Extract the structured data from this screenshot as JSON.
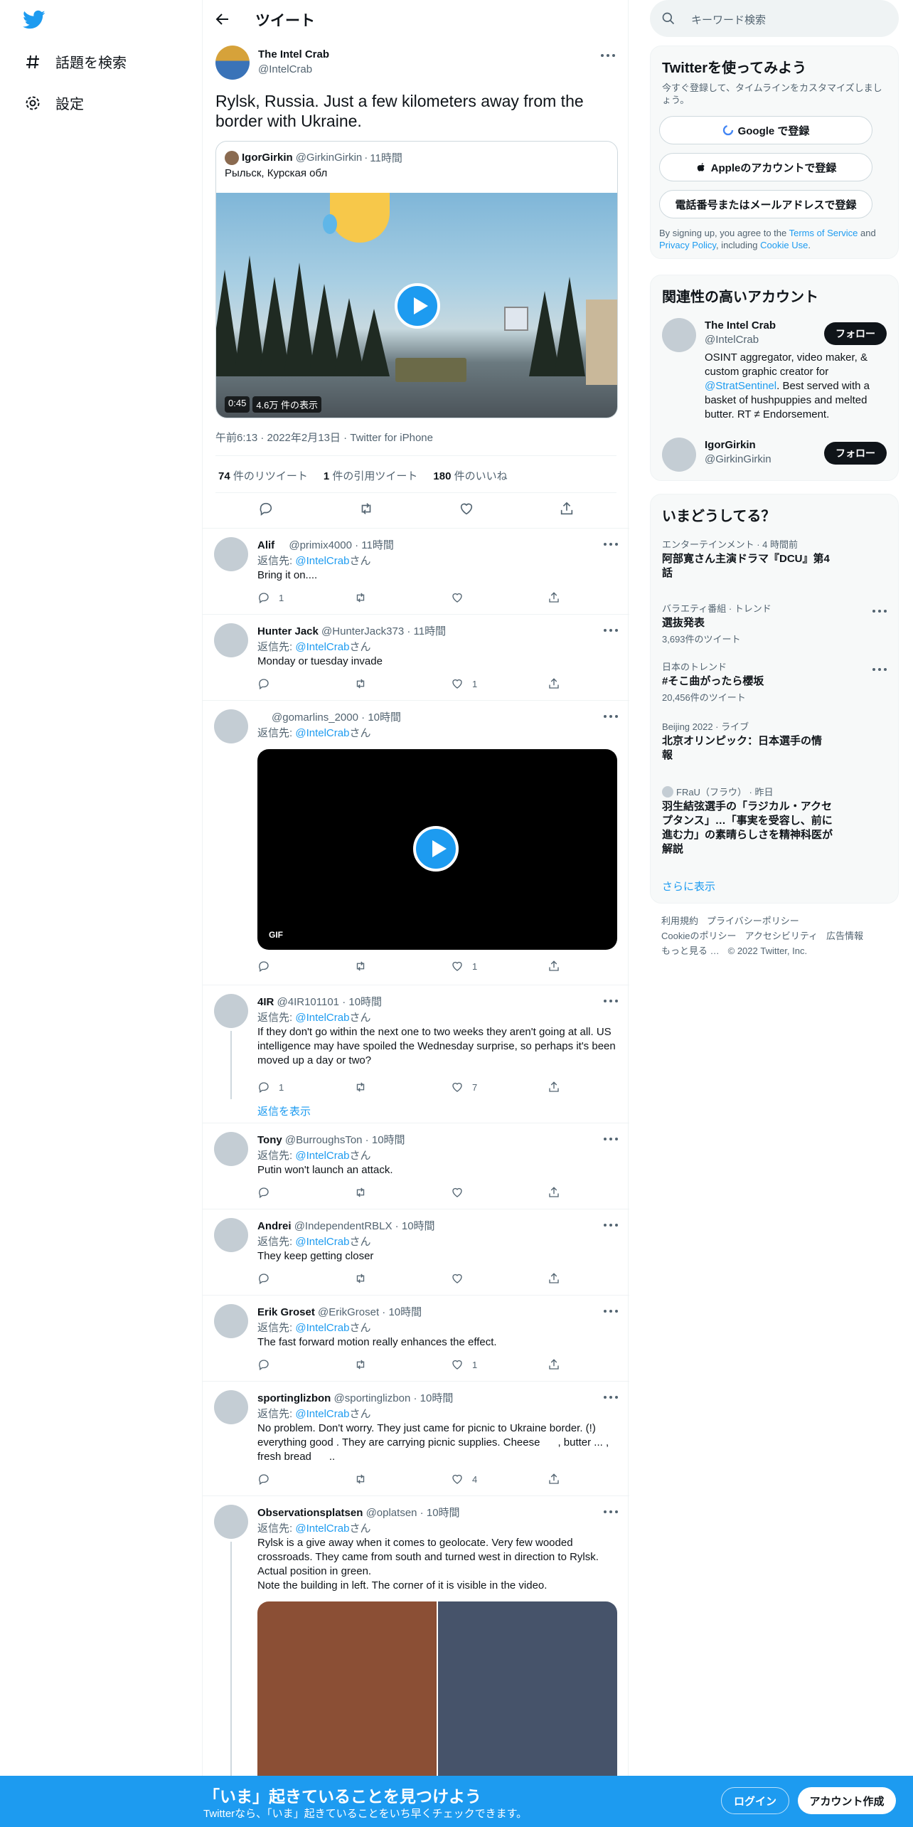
{
  "nav": {
    "items": [
      {
        "label": "話題を検索",
        "icon": "hashtag-icon"
      },
      {
        "label": "設定",
        "icon": "gear-icon"
      }
    ]
  },
  "header": {
    "title": "ツイート"
  },
  "tweet": {
    "author_name": "The Intel Crab",
    "author_handle": "@IntelCrab",
    "text": "Rylsk, Russia. Just a few kilometers away from the border with Ukraine.",
    "quote": {
      "author_name": "IgorGirkin",
      "author_handle": "@GirkinGirkin",
      "time": "11時間",
      "text": "Рыльск, Курская обл",
      "video_duration": "0:45",
      "video_views": "4.6万 件の表示"
    },
    "timestamp": "午前6:13 · 2022年2月13日 · Twitter for iPhone",
    "retweets": "74",
    "retweets_label": "件のリツイート",
    "quotes": "1",
    "quotes_label": "件の引用ツイート",
    "likes": "180",
    "likes_label": "件のいいね"
  },
  "replies": [
    {
      "name": "Alif",
      "handle": "@primix4000",
      "time": "11時間",
      "reply_to": "@IntelCrab",
      "text": "Bring it on....",
      "replies": "1",
      "likes": ""
    },
    {
      "name": "Hunter Jack",
      "handle": "@HunterJack373",
      "time": "11時間",
      "reply_to": "@IntelCrab",
      "text": "Monday or tuesday invade",
      "replies": "",
      "likes": "1"
    },
    {
      "name": "",
      "handle": "@gomarlins_2000",
      "time": "10時間",
      "reply_to": "@IntelCrab",
      "text": "",
      "gif_label": "GIF",
      "replies": "",
      "likes": "1"
    },
    {
      "name": "4IR",
      "handle": "@4IR101101",
      "time": "10時間",
      "reply_to": "@IntelCrab",
      "text": "If they don't go within the next one to two weeks they aren't going at all. US intelligence may have spoiled the Wednesday surprise, so perhaps it's been moved up a day or two?",
      "replies": "1",
      "likes": "7",
      "show_replies": "返信を表示"
    },
    {
      "name": "Tony",
      "handle": "@BurroughsTon",
      "time": "10時間",
      "reply_to": "@IntelCrab",
      "text": "Putin won't launch an attack.",
      "replies": "",
      "likes": ""
    },
    {
      "name": "Andrei",
      "handle": "@IndependentRBLX",
      "time": "10時間",
      "reply_to": "@IntelCrab",
      "text": "They keep getting closer",
      "replies": "",
      "likes": ""
    },
    {
      "name": "Erik Groset",
      "handle": "@ErikGroset",
      "time": "10時間",
      "reply_to": "@IntelCrab",
      "text": "The fast forward motion really enhances the effect.",
      "replies": "",
      "likes": "1"
    },
    {
      "name": "sportinglizbon",
      "handle": "@sportinglizbon",
      "time": "10時間",
      "reply_to": "@IntelCrab",
      "text": "No problem. Don't worry. They just came for picnic to Ukraine border. (!) everything good . They are carrying picnic supplies. Cheese      , butter ... , fresh bread      ..",
      "replies": "",
      "likes": "4"
    },
    {
      "name": "Observationsplatsen",
      "handle": "@oplatsen",
      "time": "10時間",
      "reply_to": "@IntelCrab",
      "text": "Rylsk is a give away when it comes to geolocate. Very few wooded crossroads. They came from south and turned west in direction to Rylsk. Actual position in green.\nNote the building in left. The corner of it is visible in the video."
    }
  ],
  "reply_prefix": "返信先: ",
  "reply_suffix": "さん",
  "search": {
    "placeholder": "キーワード検索"
  },
  "signup_card": {
    "title": "Twitterを使ってみよう",
    "subtitle": "今すぐ登録して、タイムラインをカスタマイズしましょう。",
    "google": "Google で登録",
    "apple": "Appleのアカウントで登録",
    "phone": "電話番号またはメールアドレスで登録",
    "terms_pre": "By signing up, you agree to the ",
    "terms_link": "Terms of Service",
    "terms_and": " and ",
    "privacy_link": "Privacy Policy",
    "terms_mid": ", including ",
    "cookie_link": "Cookie Use",
    "terms_end": "."
  },
  "related_card": {
    "title": "関連性の高いアカウント",
    "follow_label": "フォロー",
    "accounts": [
      {
        "name": "The Intel Crab",
        "handle": "@IntelCrab",
        "bio_pre": "OSINT aggregator, video maker, & custom graphic creator for ",
        "bio_link": "@StratSentinel",
        "bio_post": ". Best served with a basket of hushpuppies and melted butter. RT ≠ Endorsement."
      },
      {
        "name": "IgorGirkin",
        "handle": "@GirkinGirkin"
      }
    ]
  },
  "trends_card": {
    "title": "いまどうしてる？",
    "items": [
      {
        "category": "エンターテインメント · 4 時間前",
        "title": "阿部寛さん主演ドラマ『DCU』第4話",
        "count": ""
      },
      {
        "category": "バラエティ番組 · トレンド",
        "title": "選抜発表",
        "count": "3,693件のツイート"
      },
      {
        "category": "日本のトレンド",
        "title": "#そこ曲がったら櫻坂",
        "count": "20,456件のツイート"
      },
      {
        "category": "Beijing 2022 · ライブ",
        "title": "北京オリンピック：日本選手の情報",
        "count": ""
      },
      {
        "category": "FRaU（フラウ） · 昨日",
        "title": "羽生結弦選手の「ラジカル・アクセプタンス」…「事実を受容し、前に進む力」の素晴らしさを精神科医が解説",
        "count": ""
      }
    ],
    "show_more": "さらに表示"
  },
  "footer": {
    "links": [
      "利用規約",
      "プライバシーポリシー",
      "Cookieのポリシー",
      "アクセシビリティ",
      "広告情報",
      "もっと見る …",
      "© 2022 Twitter, Inc."
    ]
  },
  "bottom_bar": {
    "title": "「いま」起きていることを見つけよう",
    "subtitle": "Twitterなら、「いま」起きていることをいち早くチェックできます。",
    "login": "ログイン",
    "signup": "アカウント作成"
  },
  "colors": {
    "accent": "#1d9bf0",
    "text": "#0f1419",
    "muted": "#536471"
  }
}
